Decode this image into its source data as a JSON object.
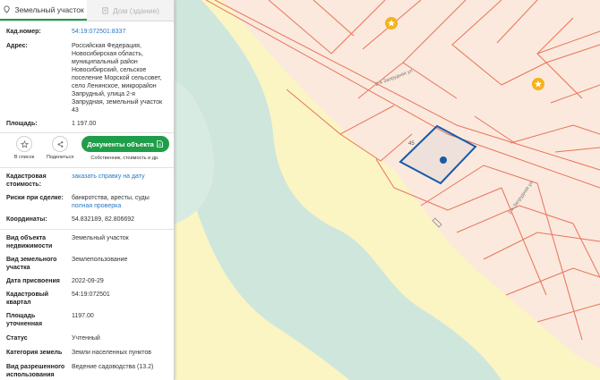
{
  "tabs": [
    {
      "label": "Земельный участок",
      "active": true
    },
    {
      "label": "Дом (здание)",
      "active": false
    }
  ],
  "info": {
    "kad_label": "Кад.номер:",
    "kad_value": "54:19:072501:8337",
    "address_label": "Адрес:",
    "address_lines": [
      "Российская Федерация,",
      "Новосибирская область,",
      "муниципальный район",
      "Новосибирский, сельское",
      "поселение Морской сельсовет,",
      "село Ленинское, микрорайон",
      "Запрудный, улица 2-я",
      "Запрудная, земельный участок",
      "43"
    ],
    "area_label": "Площадь:",
    "area_value": "1 197.00"
  },
  "actions": {
    "favorite_label": "В список",
    "share_label": "Поделиться",
    "docs_button": "Документы объекта",
    "docs_sub": "Собственник, стоимость и др."
  },
  "details": {
    "cost_label": "Кадастровая стоимость:",
    "cost_link": "заказать справку на дату",
    "risks_label": "Риски при сделке:",
    "risks_value": "банкротства, аресты, суды",
    "risks_link": "полная проверка",
    "coords_label": "Координаты:",
    "coords_value": "54.832189, 82.806692",
    "obj_type_label": "Вид объекта недвижимости",
    "obj_type_value": "Земельный участок",
    "land_type_label": "Вид земельного участка",
    "land_type_value": "Землепользование",
    "date_label": "Дата присвоения",
    "date_value": "2022-09-29",
    "quarter_label": "Кадастровый квартал",
    "quarter_value": "54:19:072501",
    "area_spec_label": "Площадь уточненная",
    "area_spec_value": "1197.00",
    "status_label": "Статус",
    "status_value": "Учтенный",
    "category_label": "Категория земель",
    "category_value": "Земли населенных пунктов",
    "usage_label": "Вид разрешенного использования",
    "usage_value": "Ведение садоводства (13.2)"
  },
  "map": {
    "parcel_number": "45",
    "street_top": "2-я Запрудная ул",
    "street_bottom": "2-я Запрудная ул",
    "colors": {
      "background": "#fbe9dd",
      "parcel_lines": "#e8735a",
      "zone": "#fbf5c3",
      "water": "#cfe6dd",
      "selected_outline": "#1a5aa8",
      "pin": "#f5b21b"
    }
  }
}
